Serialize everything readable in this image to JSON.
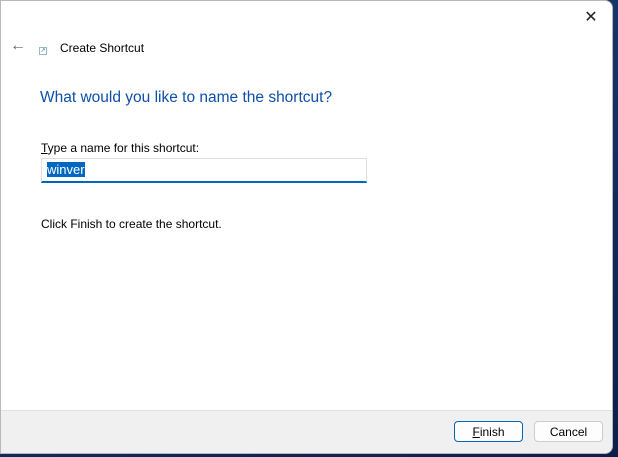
{
  "window": {
    "title": "Create Shortcut",
    "close_icon": "close-icon",
    "back_icon": "back-arrow-icon"
  },
  "main": {
    "heading": "What would you like to name the shortcut?",
    "name_label_accel": "T",
    "name_label_rest": "ype a name for this shortcut:",
    "name_value": "winver",
    "info_text": "Click Finish to create the shortcut."
  },
  "footer": {
    "finish_accel": "F",
    "finish_rest": "inish",
    "cancel": "Cancel"
  }
}
